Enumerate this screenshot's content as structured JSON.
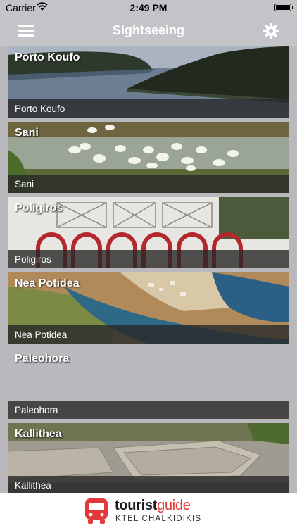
{
  "status": {
    "carrier": "Carrier",
    "time": "2:49 PM"
  },
  "nav": {
    "title": "Sightseeing",
    "menu_icon": "hamburger-menu-icon",
    "settings_icon": "gear-icon"
  },
  "places": [
    {
      "name": "Porto Koufo",
      "caption": "Porto Koufo"
    },
    {
      "name": "Sani",
      "caption": "Sani"
    },
    {
      "name": "Poligiros",
      "caption": "Poligiros"
    },
    {
      "name": "Nea Potidea",
      "caption": "Nea Potidea"
    },
    {
      "name": "Paleohora",
      "caption": "Paleohora"
    },
    {
      "name": "Kallithea",
      "caption": "Kallithea"
    }
  ],
  "footer": {
    "brand_part1": "tourist",
    "brand_part2": "guide",
    "subtitle": "KTEL CHALKIDIKIS",
    "logo_icon": "bus-icon",
    "brand_color": "#e2393b"
  }
}
